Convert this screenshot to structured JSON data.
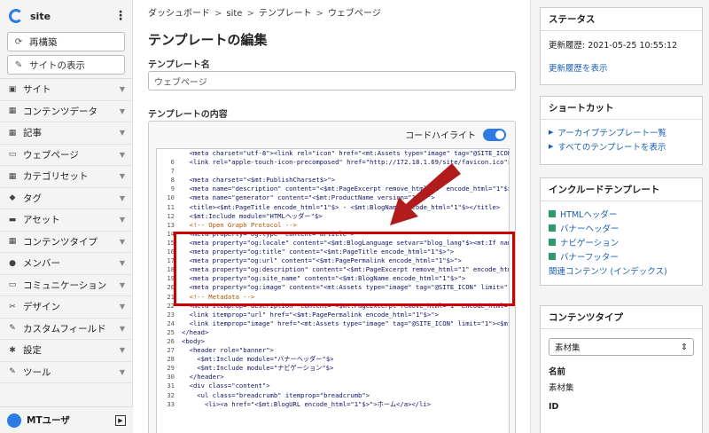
{
  "sidebar": {
    "site_name": "site",
    "rebuild_label": "再構築",
    "view_site_label": "サイトの表示",
    "nav": [
      {
        "label": "サイト",
        "icon": "site-icon"
      },
      {
        "label": "コンテンツデータ",
        "icon": "content-data-icon"
      },
      {
        "label": "記事",
        "icon": "entry-icon"
      },
      {
        "label": "ウェブページ",
        "icon": "page-icon"
      },
      {
        "label": "カテゴリセット",
        "icon": "category-set-icon"
      },
      {
        "label": "タグ",
        "icon": "tag-icon"
      },
      {
        "label": "アセット",
        "icon": "asset-icon"
      },
      {
        "label": "コンテンツタイプ",
        "icon": "content-type-icon"
      },
      {
        "label": "メンバー",
        "icon": "member-icon"
      },
      {
        "label": "コミュニケーション",
        "icon": "communication-icon"
      },
      {
        "label": "デザイン",
        "icon": "design-icon"
      },
      {
        "label": "カスタムフィールド",
        "icon": "custom-field-icon"
      },
      {
        "label": "設定",
        "icon": "settings-icon"
      },
      {
        "label": "ツール",
        "icon": "tool-icon"
      }
    ],
    "user_name": "MTユーザ"
  },
  "main": {
    "breadcrumb": [
      "ダッシュボード",
      "site",
      "テンプレート",
      "ウェブページ"
    ],
    "title": "テンプレートの編集",
    "name_label": "テンプレート名",
    "name_value": "ウェブページ",
    "content_label": "テンプレートの内容",
    "highlight_label": "コードハイライト",
    "highlight_on": true,
    "code_lines": [
      {
        "n": "",
        "text": "  <meta charset=\"utf-8\"><link rel=\"icon\" href=\"<mt:Assets type=\"image\" tag=\"@SITE_ICON\">"
      },
      {
        "n": "6",
        "text": "  <link rel=\"apple-touch-icon-precomposed\" href=\"http://172.18.1.69/site/favicon.ico\">"
      },
      {
        "n": "7",
        "text": ""
      },
      {
        "n": "8",
        "text": "  <meta charset=\"<$mt:PublishCharset$>\">"
      },
      {
        "n": "9",
        "text": "  <meta name=\"description\" content=\"<$mt:PageExcerpt remove_html=\"1\" encode_html=\"1\"$>\">"
      },
      {
        "n": "10",
        "text": "  <meta name=\"generator\" content=\"<$mt:ProductName version=\"1\"$>\">"
      },
      {
        "n": "11",
        "text": "  <title><$mt:PageTitle encode_html=\"1\"$> - <$mt:BlogName encode_html=\"1\"$></title>"
      },
      {
        "n": "12",
        "text": "  <$mt:Include module=\"HTMLヘッダー\"$>"
      },
      {
        "n": "13",
        "text": "  <!-- Open Graph Protocol -->"
      },
      {
        "n": "14",
        "text": "  <meta property=\"og:type\" content=\"article\">"
      },
      {
        "n": "15",
        "text": "  <meta property=\"og:locale\" content=\"<$mt:BlogLanguage setvar=\"blog_lang\"$><mt:If name"
      },
      {
        "n": "16",
        "text": "  <meta property=\"og:title\" content=\"<$mt:PageTitle encode_html=\"1\"$>\">"
      },
      {
        "n": "17",
        "text": "  <meta property=\"og:url\" content=\"<$mt:PagePermalink encode_html=\"1\"$>\">"
      },
      {
        "n": "18",
        "text": "  <meta property=\"og:description\" content=\"<$mt:PageExcerpt remove_html=\"1\" encode_html"
      },
      {
        "n": "19",
        "text": "  <meta property=\"og:site_name\" content=\"<$mt:BlogName encode_html=\"1\"$>\">"
      },
      {
        "n": "20",
        "text": "  <meta property=\"og:image\" content=\"<mt:Assets type=\"image\" tag=\"@SITE_ICON\" limit=\"1\""
      },
      {
        "n": "21",
        "text": "  <!-- Metadata -->"
      },
      {
        "n": "22",
        "text": "  <meta itemprop=\"description\" content=\"<$mt:PageExcerpt remove_html=\"1\" encode_html=\"1\""
      },
      {
        "n": "23",
        "text": "  <link itemprop=\"url\" href=\"<$mt:PagePermalink encode_html=\"1\"$>\">"
      },
      {
        "n": "24",
        "text": "  <link itemprop=\"image\" href=\"<mt:Assets type=\"image\" tag=\"@SITE_ICON\" limit=\"1\"><$mt:A"
      },
      {
        "n": "25",
        "text": "</head>"
      },
      {
        "n": "26",
        "text": "<body>"
      },
      {
        "n": "27",
        "text": "  <header role=\"banner\">"
      },
      {
        "n": "28",
        "text": "    <$mt:Include module=\"バナーヘッダー\"$>"
      },
      {
        "n": "29",
        "text": "    <$mt:Include module=\"ナビゲーション\"$>"
      },
      {
        "n": "30",
        "text": "  </header>"
      },
      {
        "n": "31",
        "text": "  <div class=\"content\">"
      },
      {
        "n": "32",
        "text": "    <ul class=\"breadcrumb\" itemprop=\"breadcrumb\">"
      },
      {
        "n": "33",
        "text": "      <li><a href=\"<$mt:BlogURL encode_html=\"1\"$>\">ホーム</a></li>"
      }
    ]
  },
  "right": {
    "status": {
      "title": "ステータス",
      "updated": "更新履歴: 2021-05-25 10:55:12",
      "history_link": "更新履歴を表示"
    },
    "shortcut": {
      "title": "ショートカット",
      "links": [
        "アーカイブテンプレート一覧",
        "すべてのテンプレートを表示"
      ]
    },
    "include": {
      "title": "インクルードテンプレート",
      "items": [
        "HTMLヘッダー",
        "バナーヘッダー",
        "ナビゲーション",
        "バナーフッター"
      ],
      "related": "関連コンテンツ (インデックス)"
    },
    "content_type": {
      "title": "コンテンツタイプ",
      "selected": "素材集",
      "name_label": "名前",
      "name_value": "素材集",
      "id_label": "ID"
    }
  },
  "colors": {
    "accent": "#2c7be5",
    "highlight_box": "#cc0000",
    "arrow": "#b01c1c"
  }
}
